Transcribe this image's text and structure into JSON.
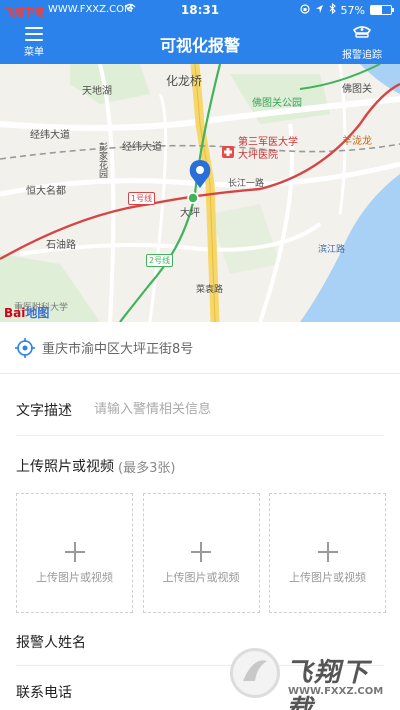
{
  "status_bar": {
    "carrier": "飞翔下载",
    "url": "WWW.FXXZ.COM",
    "time": "18:31",
    "battery": "57%",
    "battery_level": 0.57
  },
  "nav": {
    "menu_label": "菜单",
    "title": "可视化报警",
    "track_label": "报警追踪"
  },
  "map": {
    "labels": {
      "huaLongQiao": "化龙桥",
      "tianDiHu": "天地湖",
      "fodTuGongYuan": "佛图关公园",
      "foTuGuan": "佛图关",
      "jingLunDaDao1": "经纬大道",
      "jingLunDaDao2": "经纬大道",
      "pengJiaHuaYuan": "彭家花园",
      "hospital": "第三军医大学\n大坪医院",
      "yangZiLong": "羊泷龙",
      "hengDaMingDu": "恒大名都",
      "line1": "1号线",
      "daPing": "大坪",
      "changJiangYiLu": "长江一路",
      "shiYouLu": "石油路",
      "line2": "2号线",
      "caiYuanLu": "菜袁路",
      "medUniv": "重医附科大学",
      "binJiangLu": "滨江路"
    },
    "logo": "Bai",
    "logo_suffix": "地图"
  },
  "address": {
    "text": "重庆市渝中区大坪正街8号"
  },
  "form": {
    "desc_label": "文字描述",
    "desc_placeholder": "请输入警情相关信息",
    "upload_label": "上传照片或视频",
    "upload_hint": "(最多3张)",
    "upload_boxes": [
      {
        "label": "上传图片或视频"
      },
      {
        "label": "上传图片或视频"
      },
      {
        "label": "上传图片或视频"
      }
    ],
    "name_label": "报警人姓名",
    "phone_label": "联系电话"
  },
  "watermark": {
    "logo_text": "飞翔下载",
    "url": "WWW.FXXZ.COM"
  }
}
